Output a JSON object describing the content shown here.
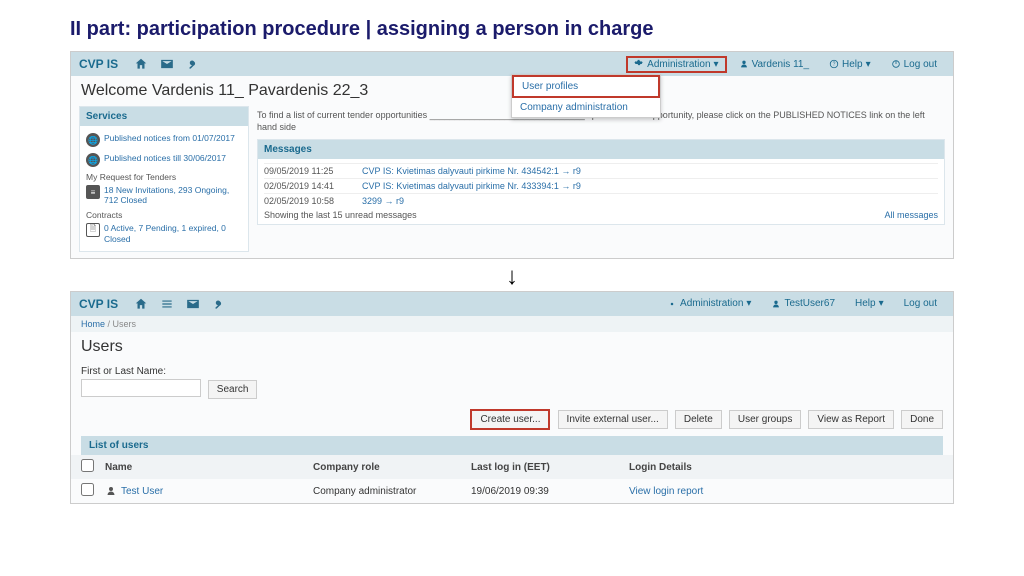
{
  "slide_title": "II part: participation procedure | assigning a person in charge",
  "app1": {
    "brand": "CVP IS",
    "nav": {
      "admin": "Administration",
      "user": "Vardenis 11_",
      "help": "Help",
      "logout": "Log out"
    },
    "dropdown": {
      "item1": "User profiles",
      "item2": "Company administration"
    },
    "welcome": "Welcome Vardenis 11_ Pavardenis 22_3",
    "services": {
      "title": "Services",
      "pub1": "Published notices from 01/07/2017",
      "pub2": "Published notices till 30/06/2017",
      "req_h": "My Request for Tenders",
      "req_t": "18 New Invitations, 293 Ongoing, 712 Closed",
      "con_h": "Contracts",
      "con_t": "0 Active, 7 Pending, 1 expired, 0 Closed"
    },
    "instr": "To find a list of current tender opportunities _______________________________ specific tender opportunity, please click on the PUBLISHED NOTICES link on the left hand side",
    "messages": {
      "title": "Messages",
      "rows": [
        {
          "d": "09/05/2019 11:25",
          "t": "CVP IS: Kvietimas dalyvauti pirkime Nr. 434542:1 → r9"
        },
        {
          "d": "02/05/2019 14:41",
          "t": "CVP IS: Kvietimas dalyvauti pirkime Nr. 433394:1 → r9"
        },
        {
          "d": "02/05/2019 10:58",
          "t": "3299 → r9"
        }
      ],
      "footer_l": "Showing the last 15 unread messages",
      "footer_r": "All messages"
    }
  },
  "app2": {
    "brand": "CVP IS",
    "nav": {
      "admin": "Administration",
      "user": "TestUser67",
      "help": "Help",
      "logout": "Log out"
    },
    "crumb_home": "Home",
    "crumb_cur": " / Users",
    "title": "Users",
    "search_label": "First or Last Name:",
    "search_btn": "Search",
    "actions": {
      "create": "Create user...",
      "invite": "Invite external user...",
      "delete": "Delete",
      "groups": "User groups",
      "report": "View as Report",
      "done": "Done"
    },
    "list_title": "List of users",
    "cols": {
      "name": "Name",
      "role": "Company role",
      "last": "Last log in (EET)",
      "login": "Login Details"
    },
    "row": {
      "name": "Test User",
      "role": "Company administrator",
      "last": "19/06/2019 09:39",
      "login": "View login report"
    }
  }
}
